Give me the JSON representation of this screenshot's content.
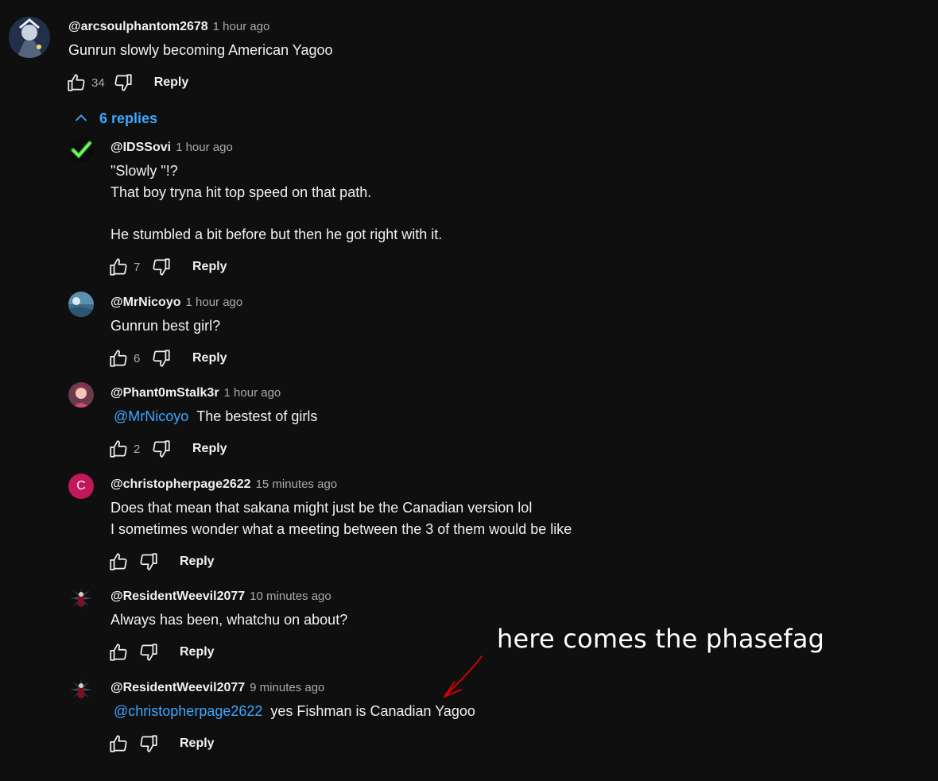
{
  "top_comment": {
    "author": "@arcsoulphantom2678",
    "time": "1 hour ago",
    "text": "Gunrun slowly becoming American Yagoo",
    "likes": "34",
    "reply_label": "Reply"
  },
  "replies_toggle": {
    "label": "6 replies"
  },
  "replies": [
    {
      "author": "@IDSSovi",
      "time": "1 hour ago",
      "lines": [
        "\"Slowly \"!?",
        "That boy tryna hit top speed on that path.",
        "",
        "He stumbled a bit before but then he got right with it."
      ],
      "likes": "7",
      "reply_label": "Reply"
    },
    {
      "author": "@MrNicoyo",
      "time": "1 hour ago",
      "lines": [
        "Gunrun best girl?"
      ],
      "likes": "6",
      "reply_label": "Reply"
    },
    {
      "author": "@Phant0mStalk3r",
      "time": "1 hour ago",
      "mention": "@MrNicoyo",
      "text": "The bestest of girls",
      "likes": "2",
      "reply_label": "Reply"
    },
    {
      "author": "@christopherpage2622",
      "time": "15 minutes ago",
      "avatar_letter": "C",
      "lines": [
        "Does that mean that sakana might just be the Canadian version lol",
        "I sometimes wonder what a meeting between the 3 of them would be like"
      ],
      "likes": "",
      "reply_label": "Reply"
    },
    {
      "author": "@ResidentWeevil2077",
      "time": "10 minutes ago",
      "lines": [
        "Always has been, whatchu on about?"
      ],
      "likes": "",
      "reply_label": "Reply"
    },
    {
      "author": "@ResidentWeevil2077",
      "time": "9 minutes ago",
      "mention": "@christopherpage2622",
      "text": "yes Fishman is Canadian Yagoo",
      "likes": "",
      "reply_label": "Reply"
    }
  ],
  "annotation": {
    "text": "here comes the phasefag"
  },
  "colors": {
    "background": "#0f0f0f",
    "text": "#f1f1f1",
    "secondary_text": "#aaaaaa",
    "link": "#3ea6ff",
    "avatar_c": "#c2185b",
    "annotation_arrow": "#e00000"
  },
  "icons": {
    "like": "thumbs-up-icon",
    "dislike": "thumbs-down-icon",
    "collapse": "chevron-up-icon"
  }
}
